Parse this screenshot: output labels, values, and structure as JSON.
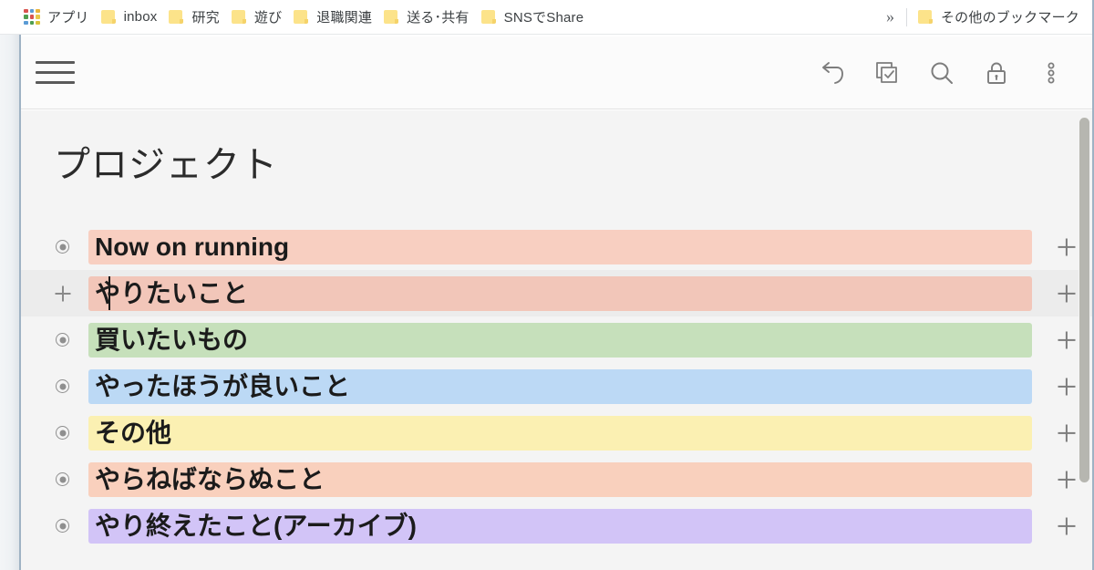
{
  "browser": {
    "bookmarks_bar": {
      "apps_label": "アプリ",
      "apps_icon": "apps-grid-icon",
      "items": [
        {
          "label": "inbox",
          "icon": "folder-icon"
        },
        {
          "label": "研究",
          "icon": "folder-icon"
        },
        {
          "label": "遊び",
          "icon": "folder-icon"
        },
        {
          "label": "退職関連",
          "icon": "folder-icon"
        },
        {
          "label": "送る･共有",
          "icon": "folder-icon"
        },
        {
          "label": "SNSでShare",
          "icon": "folder-icon"
        }
      ],
      "overflow_label": "»",
      "other_bookmarks": {
        "label": "その他のブックマーク",
        "icon": "folder-icon"
      }
    }
  },
  "app": {
    "toolbar": {
      "menu_icon": "hamburger-menu-icon",
      "actions": [
        {
          "name": "undo-icon",
          "label": "Undo"
        },
        {
          "name": "checklist-icon",
          "label": "Checklist"
        },
        {
          "name": "search-icon",
          "label": "Search"
        },
        {
          "name": "lock-icon",
          "label": "Lock"
        },
        {
          "name": "more-vertical-icon",
          "label": "More"
        }
      ]
    },
    "page_title": "プロジェクト",
    "rows": [
      {
        "text": "Now on running",
        "bullet": "radio-dot",
        "highlight": "#f8cfc1",
        "hovered": false,
        "caret": false
      },
      {
        "text": "やりたいこと",
        "bullet": "plus",
        "highlight": "#f2c6b9",
        "hovered": true,
        "caret": true
      },
      {
        "text": "買いたいもの",
        "bullet": "radio-dot",
        "highlight": "#c6e0bb",
        "hovered": false,
        "caret": false
      },
      {
        "text": "やったほうが良いこと",
        "bullet": "radio-dot",
        "highlight": "#bcd9f5",
        "hovered": false,
        "caret": false
      },
      {
        "text": "その他",
        "bullet": "radio-dot",
        "highlight": "#fbf0b2",
        "hovered": false,
        "caret": false
      },
      {
        "text": "やらねばならぬこと",
        "bullet": "radio-dot",
        "highlight": "#f9d0bd",
        "hovered": false,
        "caret": false
      },
      {
        "text": "やり終えたこと(アーカイブ)",
        "bullet": "radio-dot",
        "highlight": "#d2c4f7",
        "hovered": false,
        "caret": false
      }
    ],
    "row_add_label": "+",
    "scrollbar": {
      "name": "vertical-scrollbar"
    }
  },
  "colors": {
    "apps_grid": [
      "#d9534f",
      "#5b9bd5",
      "#e8b33a",
      "#4f9e4f",
      "#d9534f",
      "#e8c84a",
      "#5b9bd5",
      "#4f9e4f",
      "#d9c23a"
    ],
    "edge_line": "#9fb2c4",
    "content_bg": "#f4f4f4"
  }
}
